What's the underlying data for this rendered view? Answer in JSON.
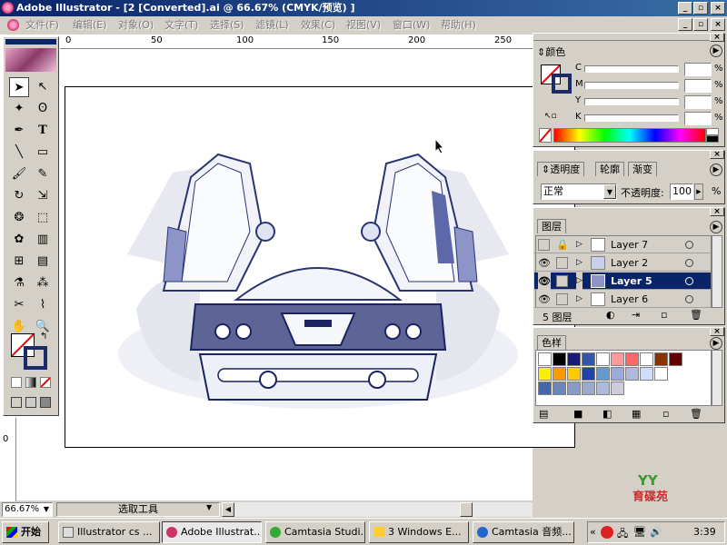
{
  "window": {
    "title": "Adobe Illustrator - [2 [Converted].ai @ 66.67% (CMYK/预览) ]"
  },
  "menu": [
    "文件(F)",
    "编辑(E)",
    "对象(O)",
    "文字(T)",
    "选择(S)",
    "滤镜(L)",
    "效果(C)",
    "视图(V)",
    "窗口(W)",
    "帮助(H)"
  ],
  "ruler": {
    "h": [
      "0",
      "50",
      "100",
      "150",
      "200",
      "250"
    ],
    "v": [
      "0"
    ]
  },
  "color_panel": {
    "title": "颜色",
    "channels": [
      "C",
      "M",
      "Y",
      "K"
    ],
    "unit": "%"
  },
  "transparency_panel": {
    "tabs": [
      "透明度",
      "轮廓",
      "渐变"
    ],
    "mode": "正常",
    "opacity_label": "不透明度:",
    "opacity_value": "100",
    "unit": "%"
  },
  "layers_panel": {
    "title": "图层",
    "layers": [
      {
        "name": "Layer 7",
        "visible": false,
        "locked": true,
        "selected": false
      },
      {
        "name": "Layer 2",
        "visible": true,
        "locked": false,
        "selected": false
      },
      {
        "name": "Layer 5",
        "visible": true,
        "locked": false,
        "selected": true
      },
      {
        "name": "Layer 6",
        "visible": true,
        "locked": false,
        "selected": false
      }
    ],
    "count": "5 图层"
  },
  "swatches_panel": {
    "title": "色样",
    "row1": [
      "#ffffff",
      "#000000",
      "#1a1a7a",
      "#3355aa",
      "#ffffff",
      "#ff9999",
      "#ff6666",
      "#ffffff",
      "#883300",
      "#660000"
    ],
    "row2": [
      "#ffee00",
      "#ff9900",
      "#ffcc00",
      "#2244aa",
      "#6699cc",
      "#99aadd",
      "#aabbdd",
      "#ccddff",
      "#ffffff"
    ],
    "row3": [
      "#4466aa",
      "#6688bb",
      "#8899cc",
      "#99aacc",
      "#aabbdd",
      "#ccccdd"
    ]
  },
  "status": {
    "zoom": "66.67%",
    "tool": "选取工具"
  },
  "watermark": "育碟苑",
  "taskbar": {
    "start": "开始",
    "buttons": [
      "Illustrator cs ...",
      "Adobe Illustrat...",
      "Camtasia Studi...",
      "3 Windows E...",
      "Camtasia 音频..."
    ],
    "time": "3:39"
  }
}
